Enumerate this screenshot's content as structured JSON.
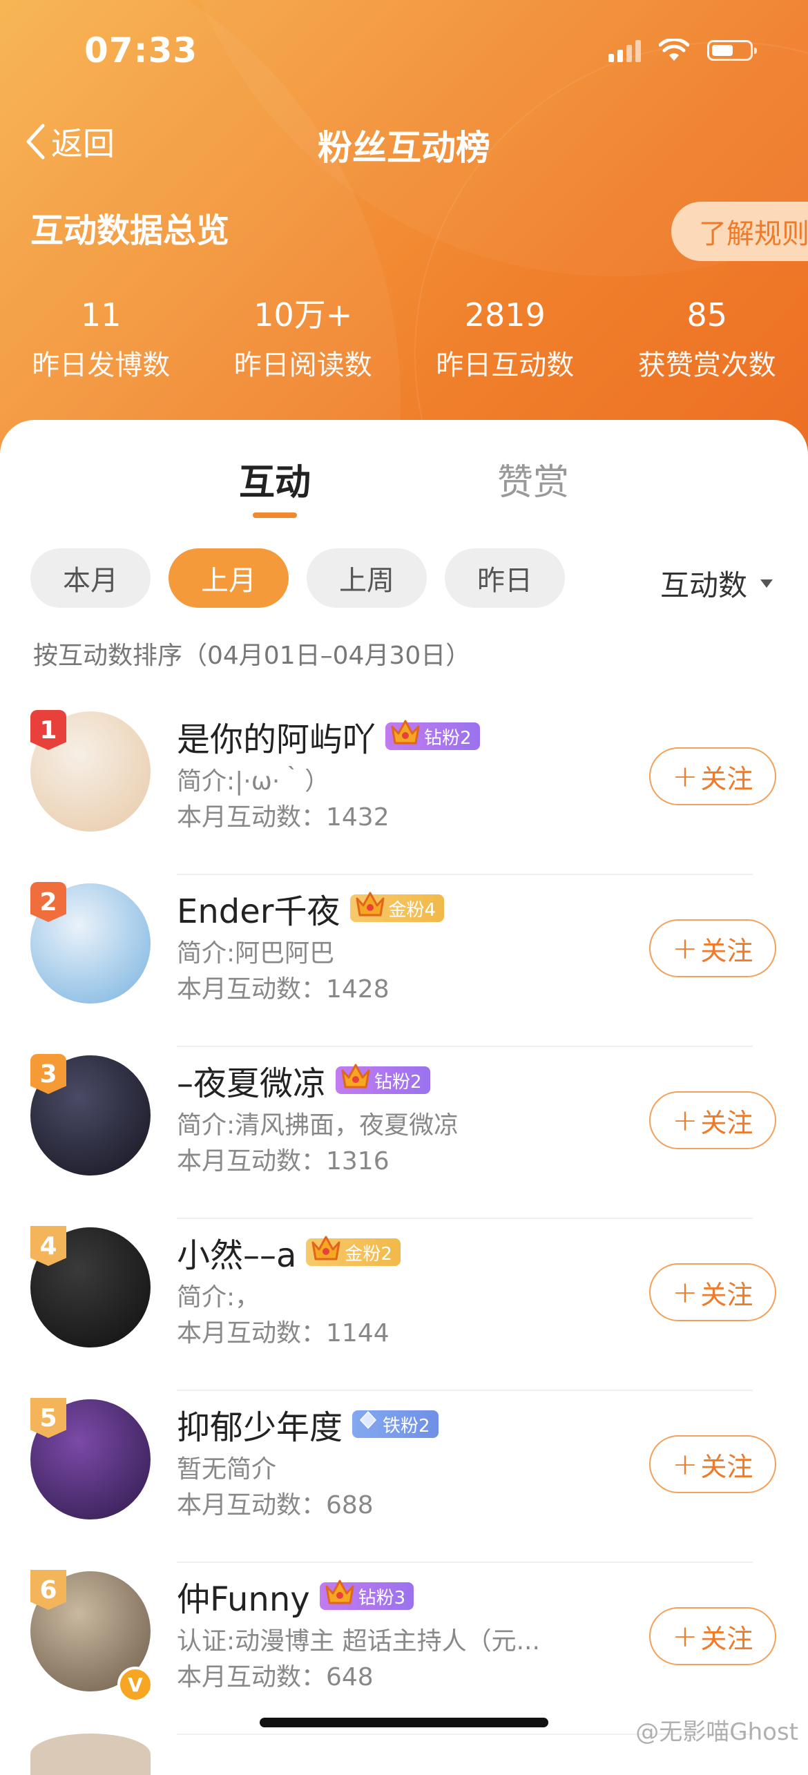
{
  "status_bar": {
    "time": "07:33"
  },
  "nav": {
    "back_label": "返回",
    "title": "粉丝互动榜"
  },
  "overview": {
    "title": "互动数据总览",
    "rules_button": "了解规则",
    "stats": [
      {
        "value": "11",
        "label": "昨日发博数"
      },
      {
        "value": "10万+",
        "label": "昨日阅读数"
      },
      {
        "value": "2819",
        "label": "昨日互动数"
      },
      {
        "value": "85",
        "label": "获赞赏次数"
      }
    ]
  },
  "tabs": [
    {
      "label": "互动",
      "active": true
    },
    {
      "label": "赞赏",
      "active": false
    }
  ],
  "filters": [
    {
      "label": "本月",
      "active": false
    },
    {
      "label": "上月",
      "active": true
    },
    {
      "label": "上周",
      "active": false
    },
    {
      "label": "昨日",
      "active": false
    }
  ],
  "sort": {
    "label": "互动数"
  },
  "sort_note": "按互动数排序（04月01日–04月30日）",
  "follow_label": "关注",
  "fans": [
    {
      "rank": "1",
      "name": "是你的阿屿吖",
      "badge": "钻粉2",
      "badge_type": "diamond",
      "bio": "简介:|·ω·｀）",
      "count": "本月互动数：1432",
      "rank_color": "#e8413b",
      "avatar_colors": [
        "#f6efe6",
        "#e8c9a6"
      ],
      "verified": false
    },
    {
      "rank": "2",
      "name": "Ender千夜",
      "badge": "金粉4",
      "badge_type": "gold",
      "bio": "简介:阿巴阿巴",
      "count": "本月互动数：1428",
      "rank_color": "#f06e3b",
      "avatar_colors": [
        "#eaf2fa",
        "#77b2df"
      ],
      "verified": false
    },
    {
      "rank": "3",
      "name": "–夜夏微凉",
      "badge": "钻粉2",
      "badge_type": "diamond",
      "bio": "简介:清风拂面，夜夏微凉",
      "count": "本月互动数：1316",
      "rank_color": "#f59a34",
      "avatar_colors": [
        "#4a4a66",
        "#15151f"
      ],
      "verified": false
    },
    {
      "rank": "4",
      "name": "小然––a",
      "badge": "金粉2",
      "badge_type": "gold",
      "bio": "简介:，",
      "count": "本月互动数：1144",
      "rank_color": "#f3b45a",
      "avatar_colors": [
        "#3a3a3a",
        "#0f0f0f"
      ],
      "verified": false
    },
    {
      "rank": "5",
      "name": "抑郁少年度",
      "badge": "铁粉2",
      "badge_type": "iron",
      "bio": "暂无简介",
      "count": "本月互动数：688",
      "rank_color": "#f3b45a",
      "avatar_colors": [
        "#7b4aa8",
        "#2e1a4a"
      ],
      "verified": false
    },
    {
      "rank": "6",
      "name": "仲Funny",
      "badge": "钻粉3",
      "badge_type": "diamond",
      "bio": "认证:动漫博主 超话主持人（元...",
      "count": "本月互动数：648",
      "rank_color": "#f3b45a",
      "avatar_colors": [
        "#c9b9a0",
        "#6a5a48"
      ],
      "verified": true
    }
  ],
  "watermark": "@无影喵Ghost"
}
